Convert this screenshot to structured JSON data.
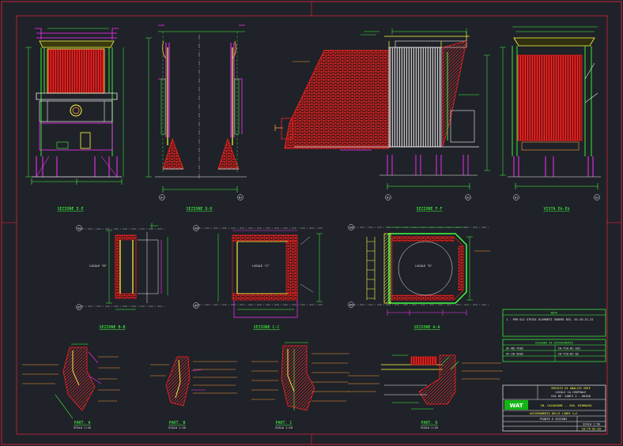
{
  "sheet": {
    "background": "#1f2228",
    "colors": {
      "frame": "#c4243b",
      "red": "#ff2020",
      "magenta": "#ff30ff",
      "yellow": "#ffff40",
      "green": "#40ff40",
      "cyan": "#40ffff",
      "white": "#f0f0f0",
      "orange": "#ff9a3a"
    }
  },
  "views": {
    "top": [
      {
        "title": "SEZIONE E-E"
      },
      {
        "title": "SEZIONE D-D"
      },
      {
        "title": "SEZIONE F-F"
      },
      {
        "title": "VISTA Ek-Ek"
      }
    ],
    "middle": [
      {
        "title": "SEZIONE B-B",
        "room": "LOCALE \"B\""
      },
      {
        "title": "SEZIONE C-C",
        "room": "LOCALE \"C\""
      },
      {
        "title": "SEZIONE A-A",
        "room": "LOCALE \"D\""
      }
    ],
    "details": [
      {
        "title": "PART. A",
        "scale": "SCALA 1:10"
      },
      {
        "title": "PART. B",
        "scale": "SCALA 1:10"
      },
      {
        "title": "PART. C",
        "scale": "SCALA 1:10"
      },
      {
        "title": "PART. D",
        "scale": "SCALA 1:10"
      }
    ]
  },
  "axis_tags": {
    "top": [
      "A1",
      "B1",
      "A1",
      "A1",
      "A1",
      "A1"
    ],
    "middle": [
      "A1",
      "B1",
      "A1",
      "B1",
      "A1",
      "B1"
    ]
  },
  "notes": {
    "header": "NOTE",
    "line1": "1 - PER GLI STESSI ELEMENTI VEDERE DIS. 0C-CH-2C-23"
  },
  "references": {
    "header": "DISEGNI DI RIFERIMENTO",
    "rows": [
      {
        "left": "SF-RD-7C00",
        "right": "C0-TCA-DC-201"
      },
      {
        "left": "SF-CB-3C00",
        "right": "C0-TCA-DC-02"
      }
    ]
  },
  "title_block": {
    "logo": "WAT",
    "company": "SERVIZI DI ANALISI ENTE",
    "lines": [
      "LOCALE 1A CENTRALE",
      "VIA DE' SANTI 2 - 00100"
    ],
    "project": "IN. CALDAIONE -- EAS. BIOMASSA",
    "drawing_title": "ASSIEMAMENTO DELLE LINEE 1+2",
    "drawing_subtitle": "PIANTE E SEZIONI",
    "scale": "SCALA 1:50",
    "number": "C0-TP-02-03"
  }
}
